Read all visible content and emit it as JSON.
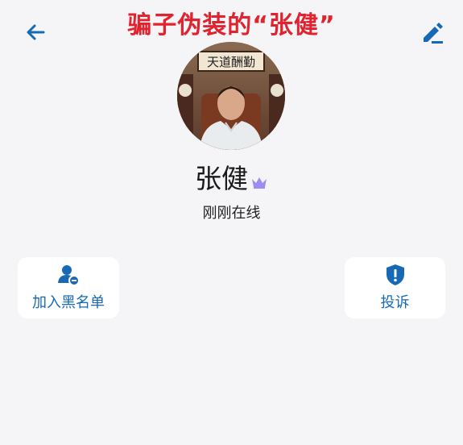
{
  "caption": "骗子伪装的“张健”",
  "profile": {
    "name": "张健",
    "status": "刚刚在线",
    "plaque_text": "天道酬勤"
  },
  "actions": {
    "block_label": "加入黑名单",
    "report_label": "投诉"
  },
  "icons": {
    "back": "arrow-left-icon",
    "edit": "pencil-icon",
    "vip": "crown-icon",
    "block": "user-block-icon",
    "report": "shield-alert-icon"
  },
  "colors": {
    "accent": "#1769b5",
    "caption": "#e0232f",
    "crown": "#9b8ef0",
    "background": "#f5f5f7"
  }
}
